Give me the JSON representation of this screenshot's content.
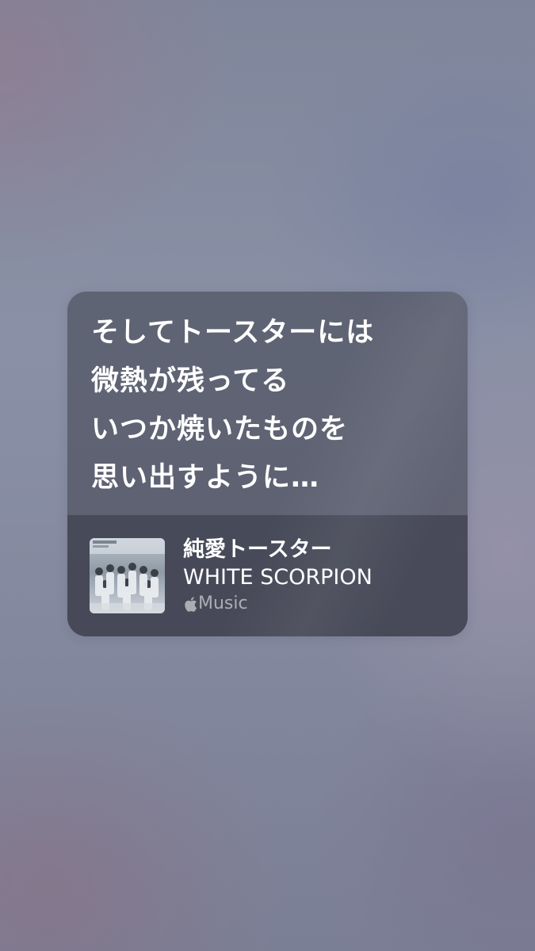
{
  "lyrics": {
    "lines": [
      "そしてトースターには",
      "微熱が残ってる",
      "いつか焼いたものを",
      "思い出すように…"
    ]
  },
  "track": {
    "title": "純愛トースター",
    "artist": "WHITE SCORPION",
    "artwork_icon": "album-artwork",
    "service_icon": "apple-logo-icon",
    "service": "Music"
  }
}
